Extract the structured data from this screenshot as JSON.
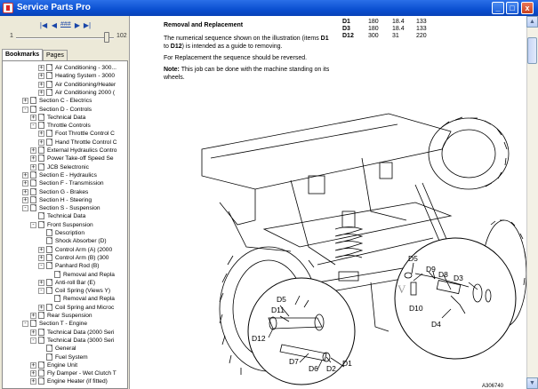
{
  "window": {
    "title": "Service Parts Pro",
    "buttons": {
      "minimize": "_",
      "maximize": "□",
      "close": "x"
    }
  },
  "navigator": {
    "first_icon": "first-page-icon",
    "prev_icon": "prev-page-icon",
    "link_label": "###",
    "next_icon": "next-page-icon",
    "last_icon": "last-page-icon",
    "slider_min": "1",
    "slider_max": "102",
    "slider_fraction": 0.93
  },
  "tabs": [
    {
      "label": "Bookmarks",
      "active": true
    },
    {
      "label": "Pages",
      "active": false
    }
  ],
  "tree": [
    {
      "label": "Air Conditioning - 300...",
      "depth": 3,
      "exp": "+",
      "doc": true
    },
    {
      "label": "Heating System - 3000",
      "depth": 3,
      "exp": "+",
      "doc": true
    },
    {
      "label": "Air Conditioning/Heater",
      "depth": 3,
      "exp": "+",
      "doc": true
    },
    {
      "label": "Air Conditioning 2000 (",
      "depth": 3,
      "exp": "+",
      "doc": true
    },
    {
      "label": "Section C - Electrics",
      "depth": 1,
      "exp": "+",
      "doc": true
    },
    {
      "label": "Section D - Controls",
      "depth": 1,
      "exp": "-",
      "doc": true
    },
    {
      "label": "Technical Data",
      "depth": 2,
      "exp": "+",
      "doc": true
    },
    {
      "label": "Throttle Controls",
      "depth": 2,
      "exp": "-",
      "doc": true
    },
    {
      "label": "Foot Throttle Control C",
      "depth": 3,
      "exp": "+",
      "doc": true
    },
    {
      "label": "Hand Throttle Control C",
      "depth": 3,
      "exp": "+",
      "doc": true
    },
    {
      "label": "External Hydraulics Contro",
      "depth": 2,
      "exp": "+",
      "doc": true
    },
    {
      "label": "Power Take-off Speed Se",
      "depth": 2,
      "exp": "+",
      "doc": true
    },
    {
      "label": "JCB Selectronic",
      "depth": 2,
      "exp": "+",
      "doc": true
    },
    {
      "label": "Section E - Hydraulics",
      "depth": 1,
      "exp": "+",
      "doc": true
    },
    {
      "label": "Section F - Transmission",
      "depth": 1,
      "exp": "+",
      "doc": true
    },
    {
      "label": "Section G - Brakes",
      "depth": 1,
      "exp": "+",
      "doc": true
    },
    {
      "label": "Section H - Steering",
      "depth": 1,
      "exp": "+",
      "doc": true
    },
    {
      "label": "Section S - Suspension",
      "depth": 1,
      "exp": "-",
      "doc": true
    },
    {
      "label": "Technical Data",
      "depth": 2,
      "exp": "",
      "doc": true
    },
    {
      "label": "Front Suspension",
      "depth": 2,
      "exp": "-",
      "doc": true
    },
    {
      "label": "Description",
      "depth": 3,
      "exp": "",
      "doc": true
    },
    {
      "label": "Shock Absorber (D)",
      "depth": 3,
      "exp": "",
      "doc": true
    },
    {
      "label": "Control Arm (A) (2000",
      "depth": 3,
      "exp": "+",
      "doc": true
    },
    {
      "label": "Control Arm (B) (300",
      "depth": 3,
      "exp": "+",
      "doc": true
    },
    {
      "label": "Panhard Rod (B)",
      "depth": 3,
      "exp": "-",
      "doc": true
    },
    {
      "label": "Removal and Repla",
      "depth": 4,
      "exp": "",
      "doc": true
    },
    {
      "label": "Anti-roll Bar (E)",
      "depth": 3,
      "exp": "+",
      "doc": true
    },
    {
      "label": "Coil Spring (Views Y)",
      "depth": 3,
      "exp": "-",
      "doc": true
    },
    {
      "label": "Removal and Repla",
      "depth": 4,
      "exp": "",
      "doc": true
    },
    {
      "label": "Coil Spring and Microc",
      "depth": 3,
      "exp": "+",
      "doc": true
    },
    {
      "label": "Rear Suspension",
      "depth": 2,
      "exp": "+",
      "doc": true
    },
    {
      "label": "Section T - Engine",
      "depth": 1,
      "exp": "-",
      "doc": true
    },
    {
      "label": "Technical Data (2000 Seri",
      "depth": 2,
      "exp": "+",
      "doc": true
    },
    {
      "label": "Technical Data (3000 Seri",
      "depth": 2,
      "exp": "-",
      "doc": true
    },
    {
      "label": "General",
      "depth": 3,
      "exp": "",
      "doc": true
    },
    {
      "label": "Fuel System",
      "depth": 3,
      "exp": "",
      "doc": true
    },
    {
      "label": "Engine Unit",
      "depth": 2,
      "exp": "+",
      "doc": true
    },
    {
      "label": "Fly Damper - Wet Clutch T",
      "depth": 2,
      "exp": "+",
      "doc": true
    },
    {
      "label": "Engine Heater (if fitted)",
      "depth": 2,
      "exp": "+",
      "doc": true
    }
  ],
  "document": {
    "section_title": "Removal and Replacement",
    "para1_a": "The numerical sequence shown on the illustration (items ",
    "para1_b": "D1",
    "para1_c": " to ",
    "para1_d": "D12",
    "para1_e": ") is intended as a guide to removing.",
    "para2": "For Replacement the sequence should be reversed.",
    "para3_a": "Note:",
    "para3_b": " This job can be done with the machine standing on its wheels.",
    "spec_rows": [
      {
        "id": "D1",
        "v1": "180",
        "v2": "18.4",
        "v3": "133"
      },
      {
        "id": "D3",
        "v1": "180",
        "v2": "18.4",
        "v3": "133"
      },
      {
        "id": "D12",
        "v1": "300",
        "v2": "31",
        "v3": "220"
      }
    ],
    "figure_labels": {
      "d5_left": "D5",
      "d11": "D11",
      "d12": "D12",
      "d7": "D7",
      "d6": "D6",
      "d2": "D2",
      "d1": "D1",
      "d5_right": "D5",
      "d10": "D10",
      "d9": "D9",
      "d8": "D8",
      "d3": "D3",
      "d4": "D4"
    },
    "figure_id": "A306740",
    "view_letter": "V"
  },
  "scrollbar": {
    "up_icon": "scroll-up-icon",
    "down_icon": "scroll-down-icon"
  }
}
